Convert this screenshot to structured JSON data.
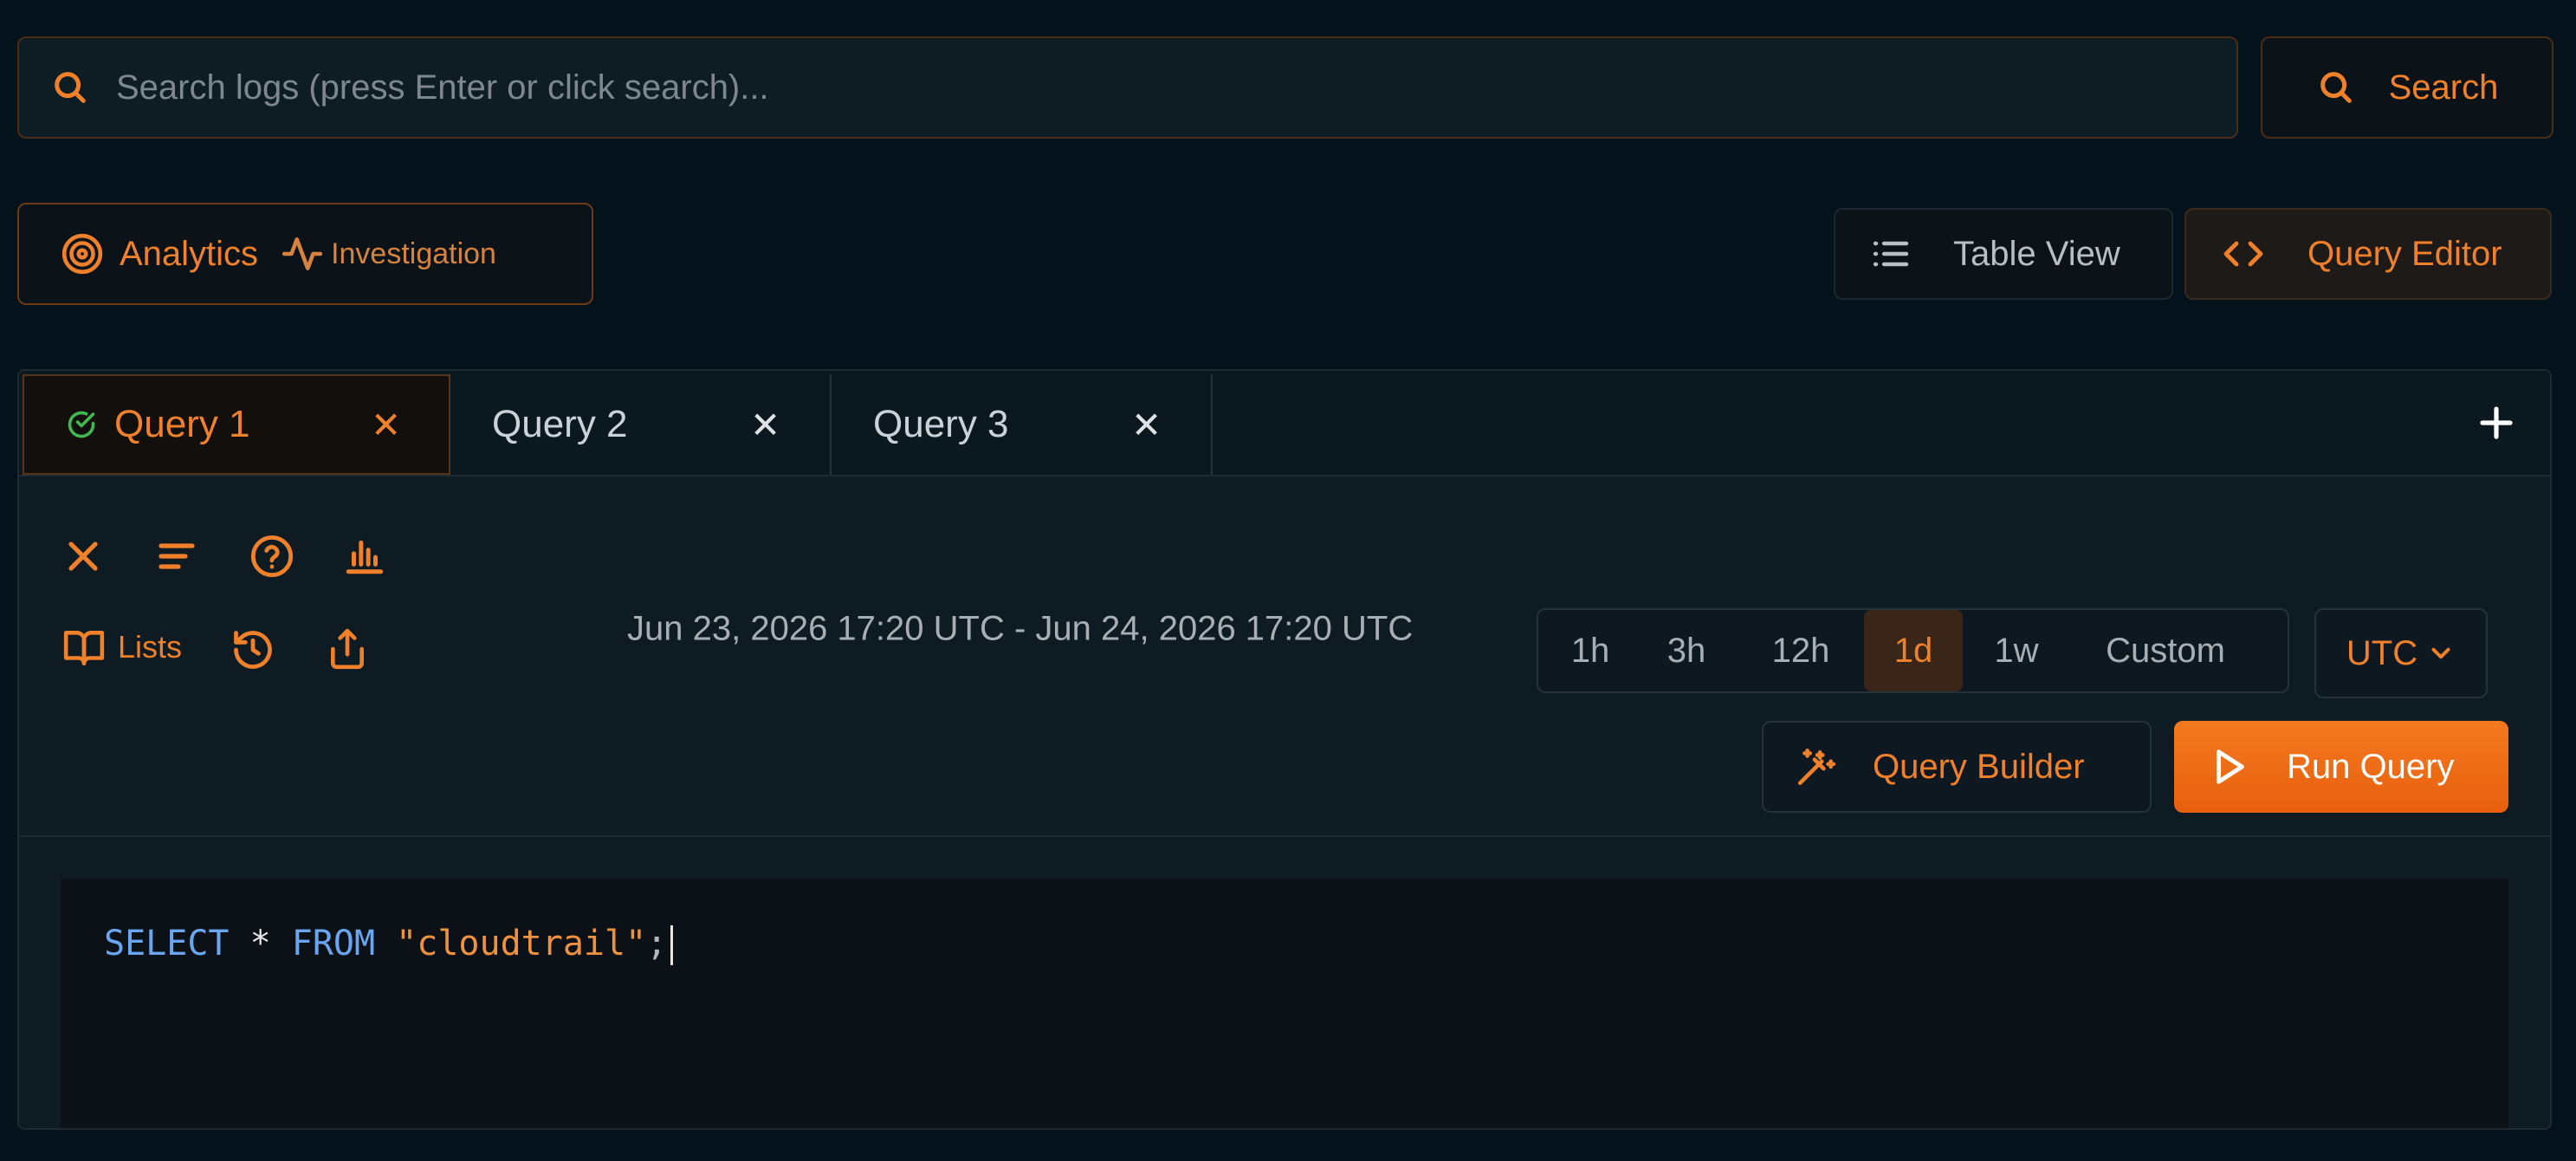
{
  "search": {
    "placeholder": "Search logs (press Enter or click search)...",
    "value": "",
    "button_label": "Search"
  },
  "modes": {
    "analytics_label": "Analytics",
    "investigation_label": "Investigation"
  },
  "views": {
    "table_view_label": "Table View",
    "query_editor_label": "Query Editor",
    "active": "Query Editor"
  },
  "tabs": [
    {
      "label": "Query 1",
      "active": true,
      "status": "success"
    },
    {
      "label": "Query 2",
      "active": false
    },
    {
      "label": "Query 3",
      "active": false
    }
  ],
  "toolbar": {
    "lists_label": "Lists",
    "date_range": "Jun 23, 2026 17:20 UTC - Jun 24, 2026 17:20 UTC",
    "ranges": [
      "1h",
      "3h",
      "12h",
      "1d",
      "1w",
      "Custom"
    ],
    "active_range": "1d",
    "timezone": "UTC",
    "query_builder_label": "Query Builder",
    "run_query_label": "Run Query"
  },
  "editor": {
    "tokens": {
      "select": "SELECT",
      "star": " * ",
      "from": "FROM",
      "space": " ",
      "table": "\"cloudtrail\"",
      "semicolon": ";"
    }
  },
  "colors": {
    "accent": "#f0812a",
    "success": "#3fb950",
    "background": "#04121b",
    "keyword": "#6aa6f0"
  }
}
